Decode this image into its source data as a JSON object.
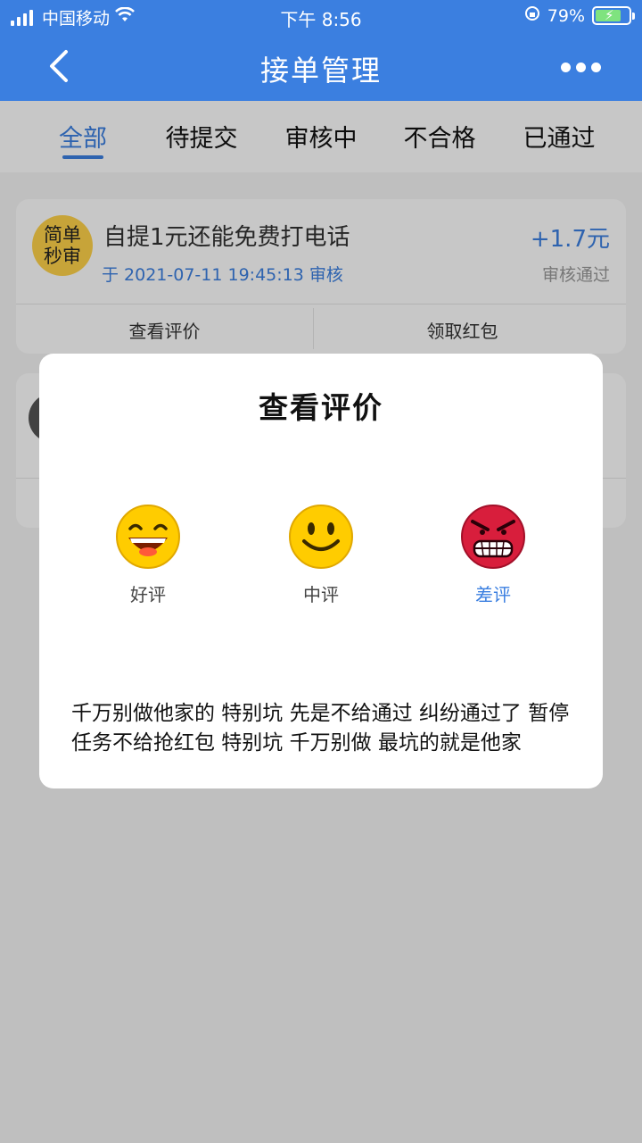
{
  "status_bar": {
    "carrier": "中国移动",
    "time": "下午 8:56",
    "battery_percent": "79%",
    "battery_level": 0.79
  },
  "nav": {
    "title": "接单管理",
    "back_icon": "chevron-left-icon",
    "more_icon": "more-dots-icon"
  },
  "tabs": [
    {
      "label": "全部",
      "active": true
    },
    {
      "label": "待提交",
      "active": false
    },
    {
      "label": "审核中",
      "active": false
    },
    {
      "label": "不合格",
      "active": false
    },
    {
      "label": "已通过",
      "active": false
    }
  ],
  "orders": [
    {
      "badge": [
        "简单",
        "秒审"
      ],
      "name": "自提1元还能免费打电话",
      "date": "于 2021-07-11 19:45:13 审核",
      "amount": "+1.7元",
      "status": "审核通过",
      "actions": [
        "查看评价",
        "领取红包"
      ]
    }
  ],
  "modal": {
    "title": "查看评价",
    "ratings": [
      {
        "label": "好评",
        "icon": "grin-face-icon",
        "selected": false
      },
      {
        "label": "中评",
        "icon": "smile-face-icon",
        "selected": false
      },
      {
        "label": "差评",
        "icon": "angry-face-icon",
        "selected": true
      }
    ],
    "comment": "千万别做他家的 特别坑 先是不给通过 纠纷通过了 暂停任务不给抢红包 特别坑 千万别做 最坑的就是他家"
  },
  "colors": {
    "primary": "#3b7fe0",
    "badge": "#ffd24a",
    "angry": "#d81e3c",
    "emoji": "#ffcc00"
  }
}
